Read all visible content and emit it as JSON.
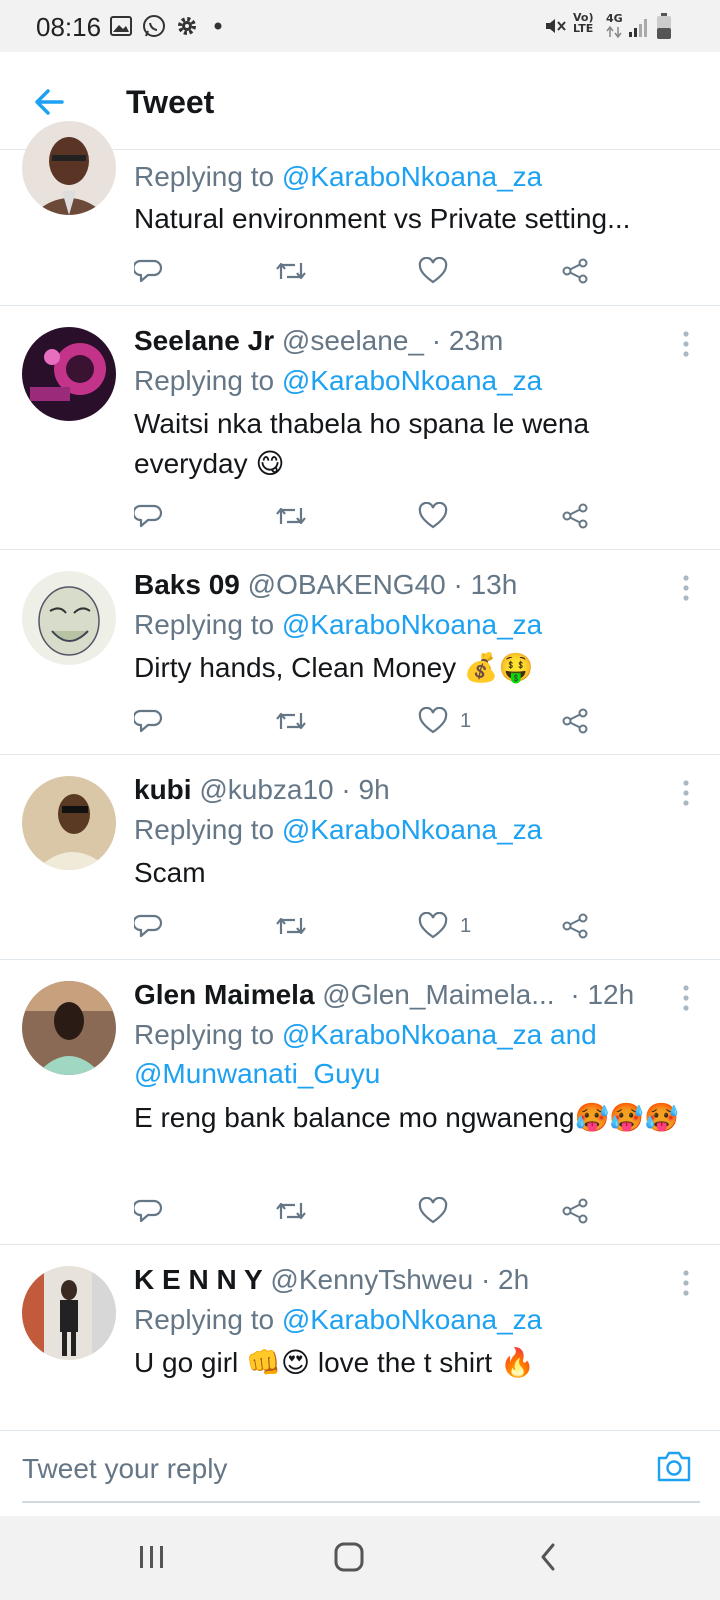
{
  "status_bar": {
    "time": "08:16",
    "left_icons": [
      "image-icon",
      "whatsapp-icon",
      "gear-icon",
      "dot-icon"
    ],
    "right_icons": [
      "mute-icon",
      "volte-icon",
      "4g-icon",
      "signal-icon",
      "battery-icon"
    ],
    "volte_label": "Vo) LTE",
    "network_label": "4G"
  },
  "header": {
    "back_icon": "back-arrow-icon",
    "title": "Tweet"
  },
  "colors": {
    "accent": "#1da1f2",
    "muted": "#657786",
    "text": "#14171a",
    "divider": "#e1e8ed"
  },
  "tweets": [
    {
      "name": "",
      "handle": "",
      "time": "",
      "replying_prefix": "Replying to",
      "mentions": [
        "@KaraboNkoana_za"
      ],
      "text": "Natural environment vs Private setting...",
      "likes": ""
    },
    {
      "name": "Seelane Jr",
      "handle": "@seelane_",
      "time": "· 23m",
      "replying_prefix": "Replying to",
      "mentions": [
        "@KaraboNkoana_za"
      ],
      "text": "Waitsi nka thabela ho spana le wena everyday 😋",
      "likes": ""
    },
    {
      "name": "Baks 09",
      "handle": "@OBAKENG40",
      "time": "· 13h",
      "replying_prefix": "Replying to",
      "mentions": [
        "@KaraboNkoana_za"
      ],
      "text": "Dirty hands, Clean Money 💰🤑",
      "likes": "1"
    },
    {
      "name": "kubi",
      "handle": "@kubza10",
      "time": "· 9h",
      "replying_prefix": "Replying to",
      "mentions": [
        "@KaraboNkoana_za"
      ],
      "text": "Scam",
      "likes": "1"
    },
    {
      "name": "Glen Maimela",
      "handle": "@Glen_Maimela...",
      "time": "· 12h",
      "replying_prefix": "Replying to",
      "mentions": [
        "@KaraboNkoana_za",
        "@Munwanati_Guyu"
      ],
      "mention_joiner": "and",
      "text": "E reng bank balance mo ngwaneng🥵🥵🥵",
      "likes": ""
    },
    {
      "name": "K E N N Y",
      "handle": "@KennyTshweu",
      "time": "· 2h",
      "replying_prefix": "Replying to",
      "mentions": [
        "@KaraboNkoana_za"
      ],
      "text": "U go girl 👊😍 love the t shirt 🔥",
      "likes": ""
    }
  ],
  "reply_bar": {
    "placeholder": "Tweet your reply",
    "camera_icon": "camera-icon"
  },
  "nav_bar": {
    "icons": [
      "recent-apps-icon",
      "home-icon",
      "back-icon"
    ]
  }
}
